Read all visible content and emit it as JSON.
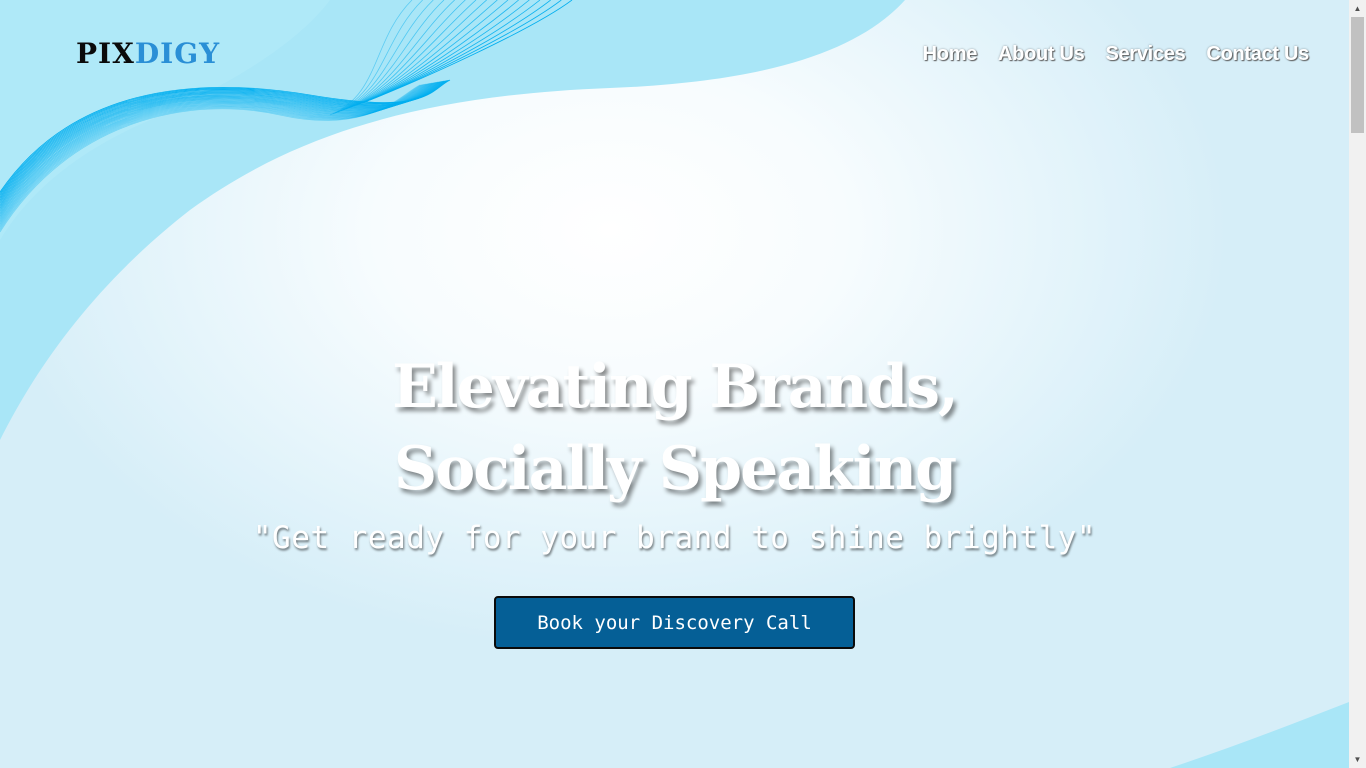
{
  "brand": {
    "part1": "PIX",
    "part2": "DIGY"
  },
  "nav": {
    "items": [
      {
        "label": "Home"
      },
      {
        "label": "About Us"
      },
      {
        "label": "Services"
      },
      {
        "label": "Contact Us"
      }
    ]
  },
  "hero": {
    "title_line1": "Elevating Brands,",
    "title_line2": "Socially Speaking",
    "tagline": "\"Get ready for your brand to shine brightly\"",
    "cta_label": "Book your Discovery Call"
  },
  "colors": {
    "background": "#dceff7",
    "wave_light": "#a9e6f7",
    "wave_lines": "#00aeef",
    "logo_dark": "#0b0b0b",
    "logo_blue": "#2a8fd6",
    "cta_bg": "#055f96"
  },
  "icons": {
    "scroll_up": "chevron-up-icon",
    "scroll_down": "chevron-down-icon"
  }
}
